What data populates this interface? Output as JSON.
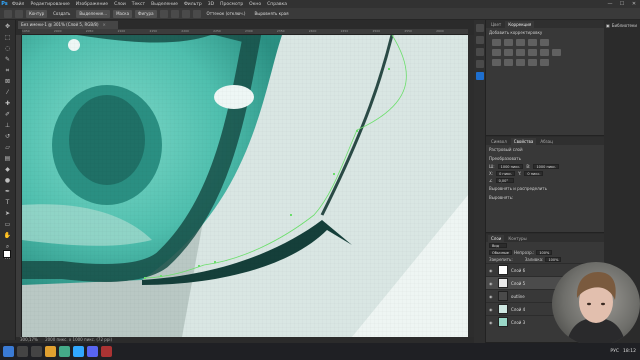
{
  "app": {
    "logo": "Ps",
    "window_controls": [
      "—",
      "☐",
      "✕"
    ]
  },
  "menu": [
    "Файл",
    "Редактирование",
    "Изображение",
    "Слои",
    "Текст",
    "Выделение",
    "Фильтр",
    "3D",
    "Просмотр",
    "Окно",
    "Справка"
  ],
  "options_bar": {
    "items": [
      "Контур",
      "Создать",
      "Выделение...",
      "Маска",
      "Фигура",
      "Оттенок (отключ.)"
    ],
    "align_label": "Выровнять края"
  },
  "document_tab": {
    "title": "Без имени-1 @ 301% (Слой 5, RGB/8)",
    "close": "×"
  },
  "ruler_ticks": [
    "1950",
    "2000",
    "2050",
    "2100",
    "2150",
    "2200",
    "2250",
    "2300",
    "2350",
    "2400",
    "2450",
    "2500",
    "2550",
    "2600"
  ],
  "status_bar": {
    "zoom": "300,17%",
    "doc_size": "2000 пикс. x 1000 пикс. (72 ppi)"
  },
  "panels": {
    "top": {
      "tabs": [
        "Цвет",
        "Коррекция"
      ],
      "active": "Коррекция",
      "subtitle": "Добавить корректировку"
    },
    "properties": {
      "tabs": [
        "Символ",
        "Свойства",
        "Абзац"
      ],
      "active": "Свойства",
      "layer_type": "Растровый слой",
      "section": "Преобразовать",
      "w_label": "Ш:",
      "w_value": "1000 пикс.",
      "h_label": "В:",
      "h_value": "1000 пикс.",
      "x_label": "X:",
      "x_value": "0 пикс.",
      "y_label": "Y:",
      "y_value": "0 пикс.",
      "angle_value": "0,00°",
      "align_section": "Выровнять и распределить",
      "align_label": "Выровнять:"
    },
    "layers": {
      "tabs": [
        "Слои",
        "Контуры"
      ],
      "active": "Слои",
      "filter_label": "Вид",
      "blend_mode": "Обычные",
      "opacity_label": "Непрозр.:",
      "opacity_value": "100%",
      "lock_label": "Закрепить:",
      "fill_label": "Заливка:",
      "fill_value": "100%",
      "items": [
        {
          "name": "Слой 6",
          "color": "#ffffff"
        },
        {
          "name": "Слой 5",
          "color": "#e8e8e8"
        },
        {
          "name": "outline",
          "color": "#4a4a4a"
        },
        {
          "name": "Слой 4",
          "color": "#cfe8e2"
        },
        {
          "name": "Слой 3",
          "color": "#9ad8c8"
        }
      ]
    }
  },
  "far_side": {
    "items": [
      "Библиотеки"
    ]
  },
  "taskbar": {
    "time": "18:12",
    "lang": "РУС"
  },
  "colors": {
    "accent": "#31a8ff",
    "canvas_teal": "#4fbfae",
    "canvas_light": "#dcecea",
    "path": "#6ce06c"
  }
}
